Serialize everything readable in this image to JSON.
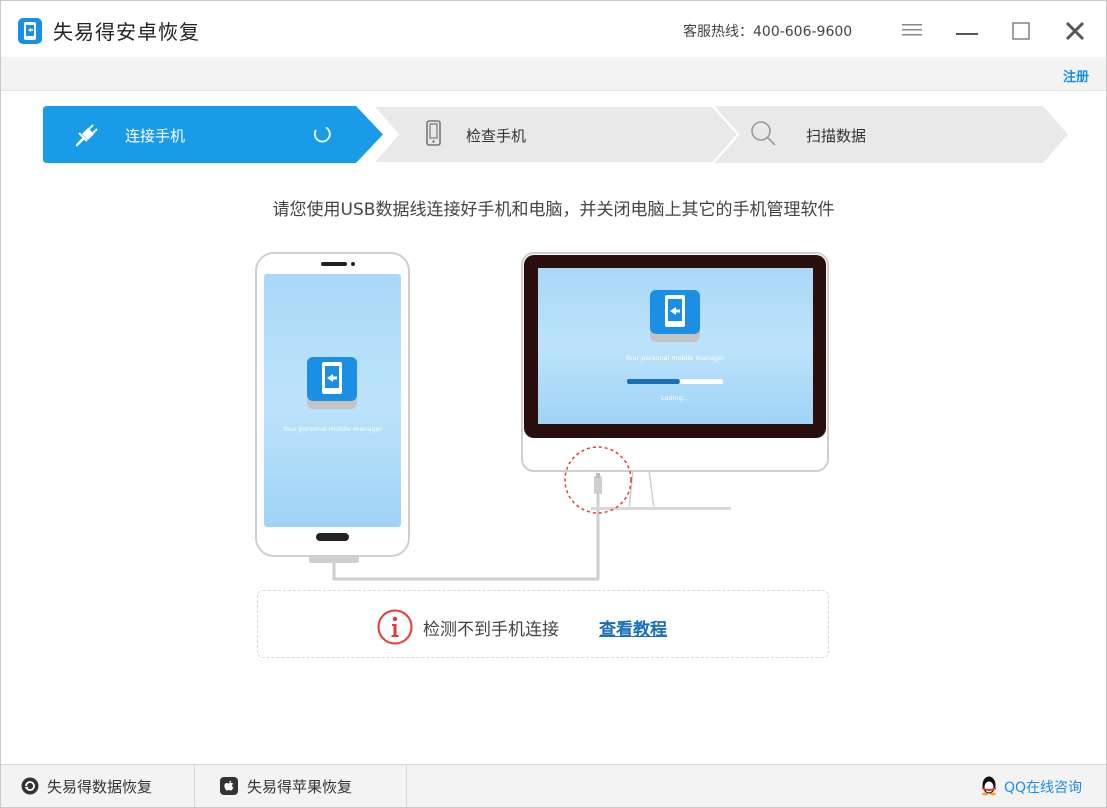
{
  "window": {
    "title": "失易得安卓恢复",
    "hotline": "客服热线：400-606-9600"
  },
  "toolbar": {
    "register_label": "注册"
  },
  "steps": [
    {
      "label": "连接手机",
      "icon": "plug-icon",
      "active": true
    },
    {
      "label": "检查手机",
      "icon": "phone-icon",
      "active": false
    },
    {
      "label": "扫描数据",
      "icon": "search-icon",
      "active": false
    }
  ],
  "main": {
    "instruction": "请您使用USB数据线连接好手机和电脑，并关闭电脑上其它的手机管理软件",
    "phone_caption": "Your personal mobile manager",
    "monitor_caption": "Your personal mobile manager",
    "monitor_loading": "Loding...",
    "monitor_progress": 0.55,
    "status_text": "检测不到手机连接",
    "tutorial_link": "查看教程"
  },
  "bottom": {
    "tabs": [
      {
        "label": "失易得数据恢复",
        "icon": "data-recovery-icon"
      },
      {
        "label": "失易得苹果恢复",
        "icon": "apple-icon"
      }
    ],
    "qq_label": "QQ在线咨询"
  },
  "colors": {
    "accent": "#1a8fe3",
    "step_inactive": "#e8e8e8",
    "error": "#e53935"
  }
}
